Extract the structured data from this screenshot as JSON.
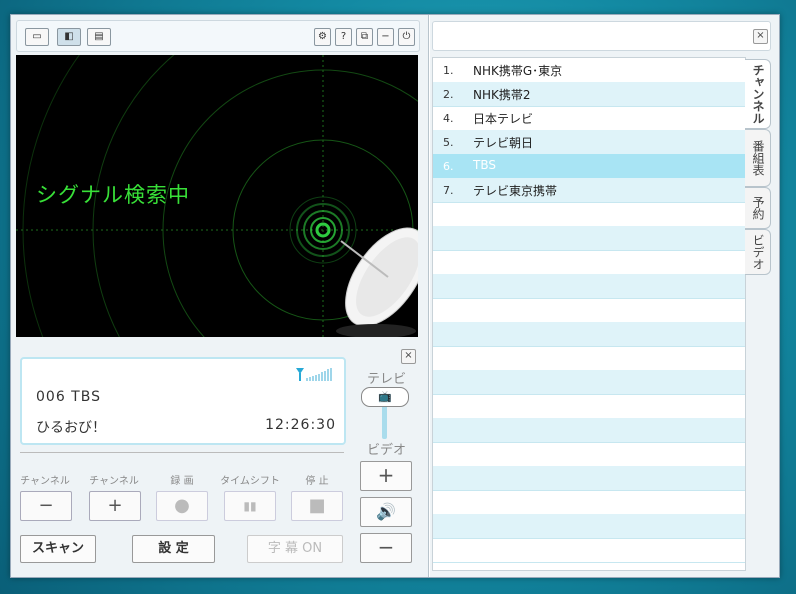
{
  "toolbar": {
    "layout_buttons": [
      "▭",
      "◧",
      "▤"
    ],
    "sys_buttons": [
      "⚙",
      "?",
      "⧉",
      "−",
      "⏻"
    ]
  },
  "video": {
    "status_text": "シグナル検索中"
  },
  "info": {
    "channel": "006 TBS",
    "program": "ひるおび！",
    "time": "12:26:30"
  },
  "controls": {
    "captions": [
      "チャンネル",
      "チャンネル",
      "録 画",
      "タイムシフト",
      "停 止"
    ],
    "ch_down": "−",
    "ch_up": "+",
    "rec": "●",
    "pause": "▮▮",
    "stop": "■",
    "scan": "スキャン",
    "settings": "設 定",
    "subtitle": "字 幕 ON",
    "tv_label": "テレビ",
    "video_label": "ビデオ",
    "vol_up": "+",
    "speaker": "🔊",
    "vol_down": "−"
  },
  "close": "×",
  "channels": [
    {
      "num": "1.",
      "name": "NHK携帯G･東京"
    },
    {
      "num": "2.",
      "name": "NHK携帯2"
    },
    {
      "num": "4.",
      "name": "日本テレビ"
    },
    {
      "num": "5.",
      "name": "テレビ朝日"
    },
    {
      "num": "6.",
      "name": "TBS"
    },
    {
      "num": "7.",
      "name": "テレビ東京携帯"
    }
  ],
  "tabs": [
    "チャンネル",
    "番組表",
    "予約",
    "ビデオ"
  ]
}
